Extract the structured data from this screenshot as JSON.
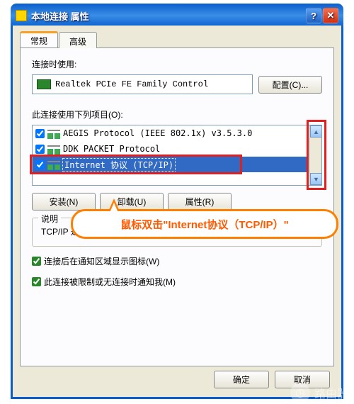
{
  "window": {
    "title": "本地连接 属性"
  },
  "tabs": [
    {
      "label": "常规",
      "active": true
    },
    {
      "label": "高级",
      "active": false
    }
  ],
  "connect_using_label": "连接时使用:",
  "adapter_name": "Realtek PCIe FE Family Control",
  "configure_btn": "配置(C)...",
  "items_label": "此连接使用下列项目(O):",
  "items": [
    {
      "checked": true,
      "label": "AEGIS Protocol (IEEE 802.1x) v3.5.3.0",
      "selected": false
    },
    {
      "checked": true,
      "label": "DDK PACKET Protocol",
      "selected": false
    },
    {
      "checked": true,
      "label": "Internet 协议 (TCP/IP)",
      "selected": true
    }
  ],
  "buttons": {
    "install": "安装(N)",
    "uninstall": "卸载(U)",
    "properties": "属性(R)"
  },
  "desc": {
    "legend": "说明",
    "text": "TCP/IP 是默认的广域网协议。它提供跨越多种互联网络的通讯。"
  },
  "checks": {
    "show_icon": "连接后在通知区域显示图标(W)",
    "notify": "此连接被限制或无连接时通知我(M)"
  },
  "dialog_buttons": {
    "ok": "确定",
    "cancel": "取消"
  },
  "callout": "鼠标双击\"Internet协议（TCP/IP）\"",
  "watermark": "路由器"
}
